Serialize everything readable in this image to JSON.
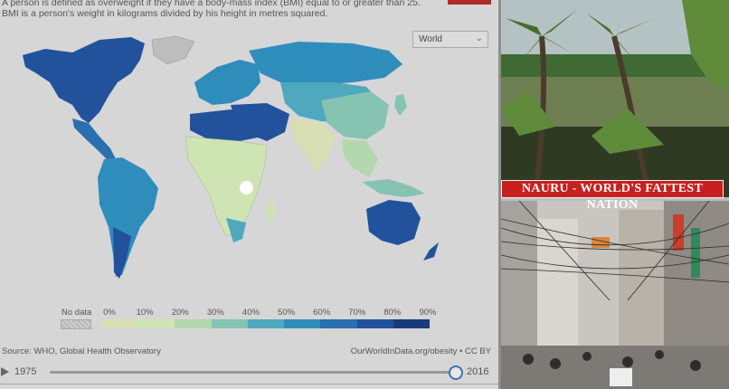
{
  "chart_panel": {
    "description": "A person is defined as overweight if they have a body-mass index (BMI) equal to or greater than 25. BMI is a person's weight in kilograms divided by his height in metres squared.",
    "region_select": {
      "value": "World"
    },
    "legend": {
      "no_data_label": "No data",
      "ticks": [
        "0%",
        "10%",
        "20%",
        "30%",
        "40%",
        "50%",
        "60%",
        "70%",
        "80%",
        "90%"
      ],
      "colors": [
        "#d7dfb3",
        "#cfe4b3",
        "#b3d8ad",
        "#86c3b2",
        "#4ea8be",
        "#2f8dbc",
        "#2a6fb0",
        "#23529c",
        "#1b3a7e"
      ]
    },
    "source": "Source: WHO, Global Health Observatory",
    "credit": "OurWorldInData.org/obesity • CC BY",
    "timeline": {
      "start_year": "1975",
      "end_year": "2016",
      "position": 1.0
    }
  },
  "photos": {
    "top_scene": "tropical-palms-lagoon",
    "bottom_scene": "busy-street-power-lines",
    "banner": "NAURU - WORLD'S FATTEST NATION"
  }
}
